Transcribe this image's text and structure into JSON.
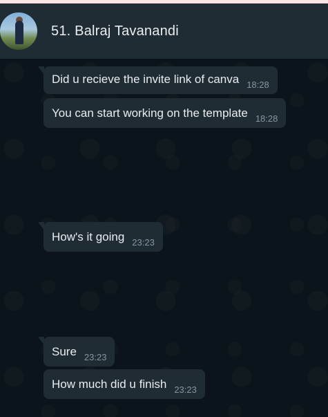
{
  "header": {
    "contact_name": "51. Balraj Tavanandi"
  },
  "messages": [
    {
      "text": "Did u recieve the invite link of canva",
      "time": "18:28"
    },
    {
      "text": "You can start working on the template",
      "time": "18:28"
    },
    {
      "text": "How's it going",
      "time": "23:23"
    },
    {
      "text": "Sure",
      "time": "23:23"
    },
    {
      "text": "How much did u finish",
      "time": "23:23"
    }
  ],
  "colors": {
    "header_bg": "#202c33",
    "chat_bg": "#0b141a",
    "bubble_bg": "#202c33",
    "text": "#e9edef",
    "time": "#8696a0"
  }
}
